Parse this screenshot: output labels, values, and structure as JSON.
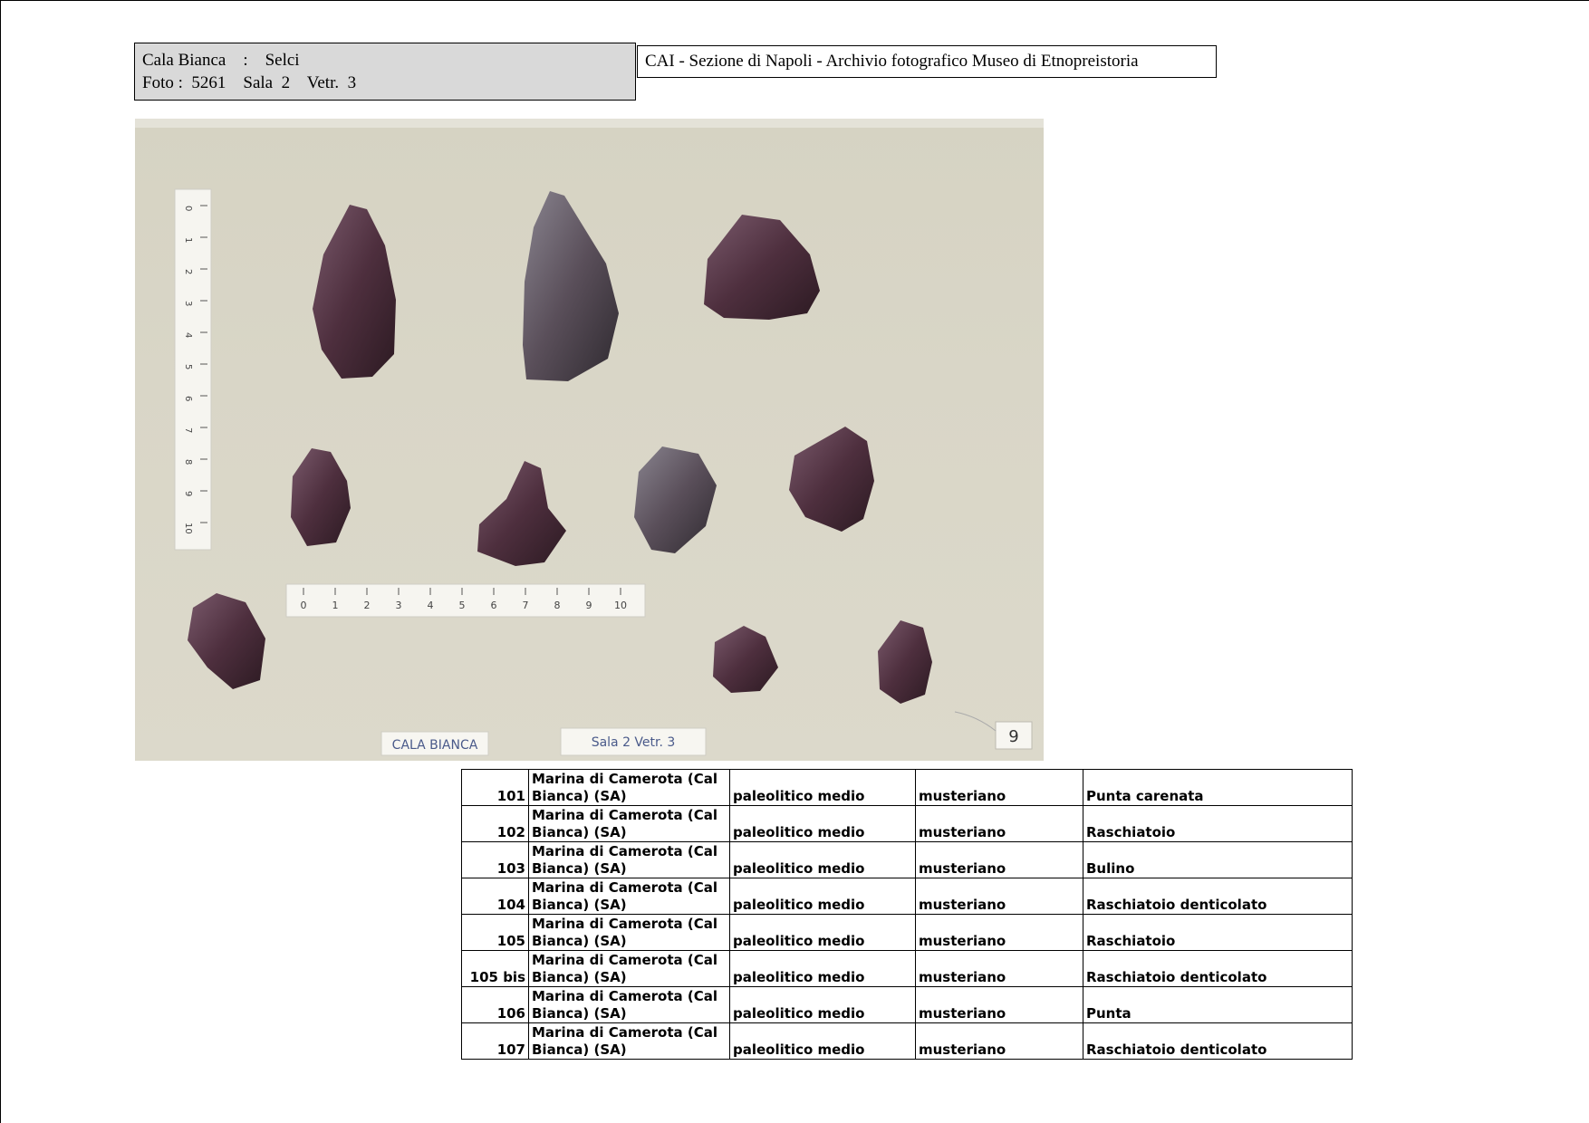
{
  "label": {
    "line1": "Cala Bianca    :    Selci",
    "line2": "Foto :  5261    Sala  2    Vetr.  3"
  },
  "header": {
    "title": "CAI - Sezione di Napoli  - Archivio fotografico Museo di Etnopreistoria"
  },
  "photo": {
    "ruler_vertical_ticks": [
      "0",
      "1",
      "2",
      "3",
      "4",
      "5",
      "6",
      "7",
      "8",
      "9",
      "10"
    ],
    "ruler_horizontal_ticks": [
      "0",
      "1",
      "2",
      "3",
      "4",
      "5",
      "6",
      "7",
      "8",
      "9",
      "10"
    ],
    "card_site": "CALA BIANCA",
    "card_location": "Sala 2  Vetr. 3",
    "tag_number": "9"
  },
  "catalog": {
    "rows": [
      {
        "num": "101",
        "site_line1": "Marina di Camerota (Cal",
        "site_line2": "Bianca) (SA)",
        "period": "paleolitico medio",
        "culture": "musteriano",
        "type": "Punta carenata"
      },
      {
        "num": "102",
        "site_line1": "Marina di Camerota (Cal",
        "site_line2": "Bianca) (SA)",
        "period": "paleolitico medio",
        "culture": "musteriano",
        "type": "Raschiatoio"
      },
      {
        "num": "103",
        "site_line1": "Marina di Camerota (Cal",
        "site_line2": "Bianca) (SA)",
        "period": "paleolitico medio",
        "culture": "musteriano",
        "type": "Bulino"
      },
      {
        "num": "104",
        "site_line1": "Marina di Camerota (Cal",
        "site_line2": "Bianca) (SA)",
        "period": "paleolitico medio",
        "culture": "musteriano",
        "type": "Raschiatoio denticolato"
      },
      {
        "num": "105",
        "site_line1": "Marina di Camerota (Cal",
        "site_line2": "Bianca) (SA)",
        "period": "paleolitico medio",
        "culture": "musteriano",
        "type": "Raschiatoio"
      },
      {
        "num": "105 bis",
        "site_line1": "Marina di Camerota (Cal",
        "site_line2": "Bianca) (SA)",
        "period": "paleolitico medio",
        "culture": "musteriano",
        "type": "Raschiatoio denticolato"
      },
      {
        "num": "106",
        "site_line1": "Marina di Camerota (Cal",
        "site_line2": "Bianca) (SA)",
        "period": "paleolitico medio",
        "culture": "musteriano",
        "type": "Punta"
      },
      {
        "num": "107",
        "site_line1": "Marina di Camerota (Cal",
        "site_line2": "Bianca) (SA)",
        "period": "paleolitico medio",
        "culture": "musteriano",
        "type": "Raschiatoio denticolato"
      }
    ]
  }
}
